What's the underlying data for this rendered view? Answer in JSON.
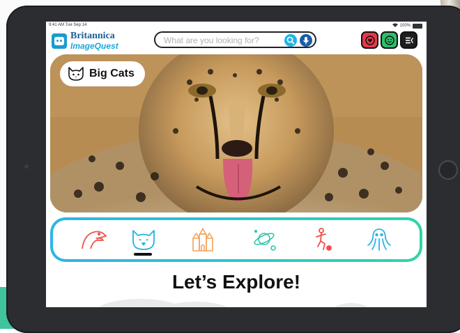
{
  "status_bar": {
    "time": "9:41 AM  Tue Sep 14",
    "battery": "100%"
  },
  "logo": {
    "line1": "Britannica",
    "line2": "ImageQuest"
  },
  "search": {
    "placeholder": "What are you looking for?",
    "value": ""
  },
  "header_buttons": [
    {
      "name": "favorites",
      "icon": "heart-icon",
      "color": "#e53a4a"
    },
    {
      "name": "profile",
      "icon": "smiley-icon",
      "color": "#2fbd6c"
    },
    {
      "name": "menu",
      "icon": "menu-icon",
      "color": "#1e1e1e"
    }
  ],
  "hero": {
    "category_label": "Big Cats",
    "category_icon": "cat-face-icon"
  },
  "categories": [
    {
      "id": "dinosaurs",
      "icon": "dinosaur-icon",
      "color": "#f0504a"
    },
    {
      "id": "big-cats",
      "icon": "cat-face-icon",
      "color": "#21b3e4",
      "selected": true
    },
    {
      "id": "buildings",
      "icon": "castle-icon",
      "color": "#f3a25a"
    },
    {
      "id": "space",
      "icon": "planet-icon",
      "color": "#2fc5a9"
    },
    {
      "id": "sports",
      "icon": "football-player-icon",
      "color": "#f0504a"
    },
    {
      "id": "sea-life",
      "icon": "octopus-icon",
      "color": "#2fb4e8"
    }
  ],
  "heading": "Let’s Explore!",
  "colors": {
    "brand_blue": "#1b9bd1",
    "accent_teal": "#2fc6c9",
    "accent_green": "#3fc49d"
  }
}
